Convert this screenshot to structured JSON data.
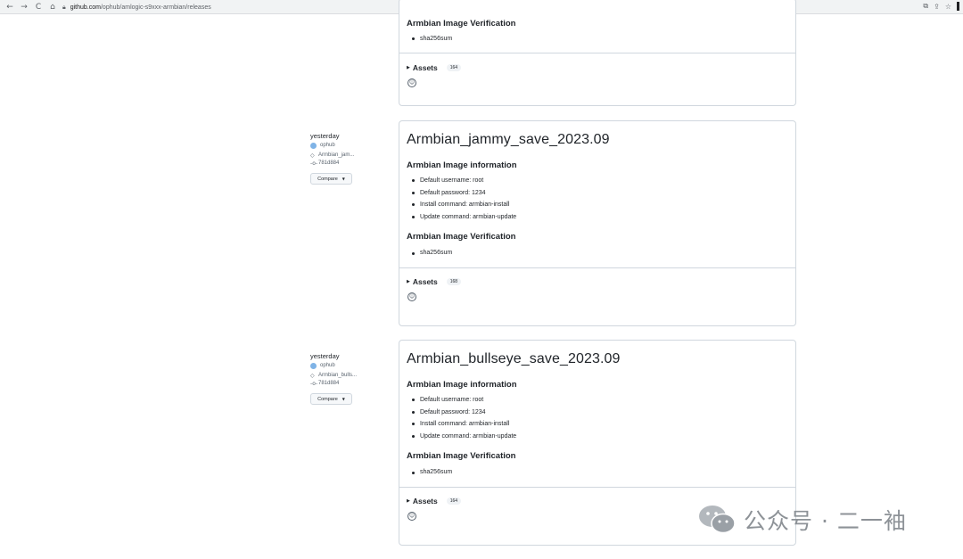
{
  "browser": {
    "back": "←",
    "forward": "→",
    "reload": "C",
    "home": "⌂",
    "url_host": "github.com",
    "url_path": "/ophub/amlogic-s9xxx-armbian/releases"
  },
  "release0": {
    "verification_heading": "Armbian Image Verification",
    "verification_items": [
      "sha256sum"
    ],
    "assets_label": "Assets",
    "assets_count": "164"
  },
  "release1": {
    "date": "yesterday",
    "author": "ophub",
    "tag": "Armbian_jam...",
    "commit": "781d884",
    "compare": "Compare",
    "title": "Armbian_jammy_save_2023.09",
    "info_heading": "Armbian Image information",
    "info_items": [
      "Default username: root",
      "Default password: 1234",
      "Install command: armbian-install",
      "Update command: armbian-update"
    ],
    "verification_heading": "Armbian Image Verification",
    "verification_items": [
      "sha256sum"
    ],
    "assets_label": "Assets",
    "assets_count": "168"
  },
  "release2": {
    "date": "yesterday",
    "author": "ophub",
    "tag": "Armbian_bulls...",
    "commit": "781d884",
    "compare": "Compare",
    "title": "Armbian_bullseye_save_2023.09",
    "info_heading": "Armbian Image information",
    "info_items": [
      "Default username: root",
      "Default password: 1234",
      "Install command: armbian-install",
      "Update command: armbian-update"
    ],
    "verification_heading": "Armbian Image Verification",
    "verification_items": [
      "sha256sum"
    ],
    "assets_label": "Assets",
    "assets_count": "164"
  },
  "watermark": {
    "text": "公众号 · 二一袖"
  },
  "icons": {
    "lock": "lock-icon",
    "tag": "tag-icon",
    "commit": "commit-icon",
    "smiley": "smiley-icon",
    "caret": "caret-down-icon",
    "triangle": "disclosure-triangle-icon"
  }
}
